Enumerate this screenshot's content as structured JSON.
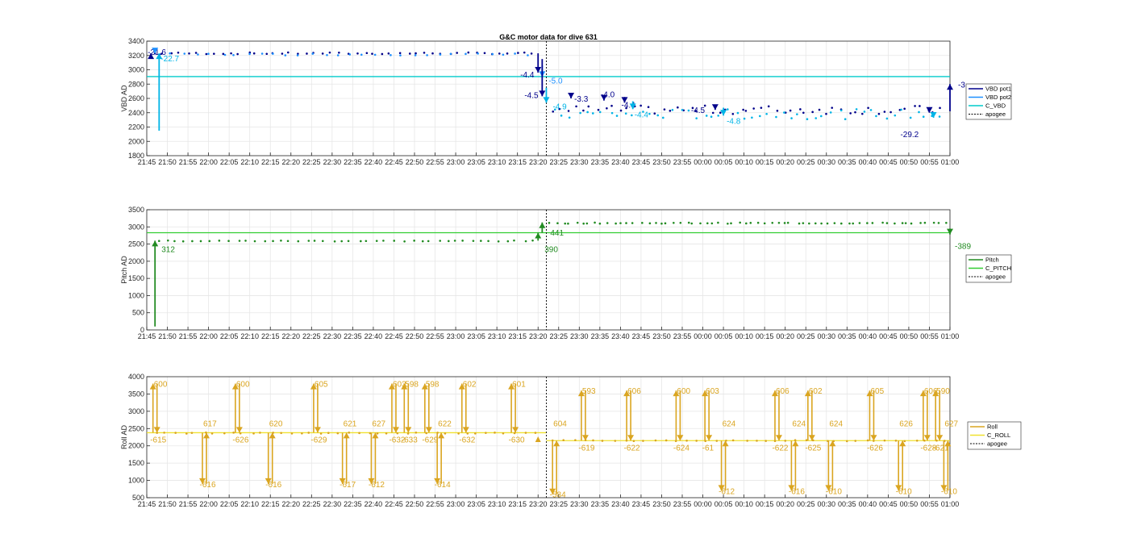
{
  "figure_title": "G&C motor data for dive 631",
  "x_ticks": [
    "21:45",
    "21:50",
    "21:55",
    "22:00",
    "22:05",
    "22:10",
    "22:15",
    "22:20",
    "22:25",
    "22:30",
    "22:35",
    "22:40",
    "22:45",
    "22:50",
    "22:55",
    "23:00",
    "23:05",
    "23:10",
    "23:15",
    "23:20",
    "23:25",
    "23:30",
    "23:35",
    "23:40",
    "23:45",
    "23:50",
    "23:55",
    "00:00",
    "00:05",
    "00:10",
    "00:15",
    "00:20",
    "00:25",
    "00:30",
    "00:35",
    "00:40",
    "00:45",
    "00:50",
    "00:55",
    "01:00"
  ],
  "apogee_time": "23:22",
  "chart_data": [
    {
      "type": "scatter",
      "ylabel": "VBD AD",
      "ylim": [
        3400,
        1800
      ],
      "yticks": [
        1800,
        2000,
        2200,
        2400,
        2600,
        2800,
        3000,
        3200,
        3400
      ],
      "reversed": true,
      "grid": true,
      "legend_position": "right",
      "legend": [
        {
          "name": "VBD pot1",
          "color": "#00008b",
          "style": "solid"
        },
        {
          "name": "VBD pot2",
          "color": "#1e90ff",
          "style": "solid"
        },
        {
          "name": "C_VBD",
          "color": "#00cccc",
          "style": "solid"
        },
        {
          "name": "apogee",
          "color": "#000000",
          "style": "dashed"
        }
      ],
      "reference_lines": [
        {
          "name": "C_VBD",
          "value": 2905,
          "color": "#00cccc"
        }
      ],
      "dot_series": [
        {
          "name": "VBD pot1",
          "color": "#00008b",
          "from": "21:47",
          "to": "23:19",
          "value": 3230,
          "count": 46,
          "jitter": 12
        },
        {
          "name": "VBD pot2",
          "color": "#1e90ff",
          "from": "21:48",
          "to": "23:18",
          "value": 3215,
          "count": 30,
          "jitter": 14
        },
        {
          "name": "VBD pot1",
          "color": "#00008b",
          "from": "23:24",
          "to": "00:58",
          "value": 2440,
          "count": 55,
          "jitter": 60
        },
        {
          "name": "VBD pot2",
          "color": "#00b4e6",
          "from": "23:24",
          "to": "00:58",
          "value": 2380,
          "count": 50,
          "jitter": 70
        }
      ],
      "arrows": [
        {
          "t": "21:46",
          "from": 3200,
          "to": 3230,
          "color": "#00008b",
          "label": "-21.6",
          "lx": -4,
          "ly": 2
        },
        {
          "t": "21:47",
          "from": 3260,
          "to": 3230,
          "color": "#1e90ff",
          "label": "",
          "lx": 0,
          "ly": 0
        },
        {
          "t": "21:48",
          "from": 2150,
          "to": 3230,
          "color": "#00b4e6",
          "label": "-22.7",
          "lx": 2,
          "ly": 10
        },
        {
          "t": "23:20",
          "from": 3230,
          "to": 2960,
          "color": "#00008b",
          "label": "-4.4",
          "lx": -22,
          "ly": 6
        },
        {
          "t": "23:21",
          "from": 3060,
          "to": 2900,
          "color": "#1e90ff",
          "label": "-5.0",
          "lx": 8,
          "ly": 8
        },
        {
          "t": "23:21",
          "from": 3150,
          "to": 2630,
          "color": "#00008b",
          "label": "-4.5",
          "lx": -22,
          "ly": 2
        },
        {
          "t": "23:22",
          "from": 2750,
          "to": 2540,
          "color": "#00b4e6",
          "label": "-4.9",
          "lx": 8,
          "ly": 8
        },
        {
          "t": "23:28",
          "from": 2640,
          "to": 2600,
          "color": "#00008b",
          "label": "-3.3",
          "lx": 4,
          "ly": 4
        },
        {
          "t": "23:36",
          "from": 2620,
          "to": 2570,
          "color": "#00008b",
          "label": "-4.0",
          "lx": -4,
          "ly": -4
        },
        {
          "t": "23:41",
          "from": 2620,
          "to": 2540,
          "color": "#00008b",
          "label": "-4.4",
          "lx": -4,
          "ly": 6
        },
        {
          "t": "23:43",
          "from": 2560,
          "to": 2450,
          "color": "#00b4e6",
          "label": "-4.4",
          "lx": 2,
          "ly": 10
        },
        {
          "t": "00:03",
          "from": 2500,
          "to": 2440,
          "color": "#00008b",
          "label": "-4.5",
          "lx": -30,
          "ly": 4
        },
        {
          "t": "00:05",
          "from": 2470,
          "to": 2360,
          "color": "#00b4e6",
          "label": "-4.8",
          "lx": 4,
          "ly": 10
        },
        {
          "t": "00:55",
          "from": 2440,
          "to": 2400,
          "color": "#00008b",
          "label": "-29.2",
          "lx": -36,
          "ly": 30
        },
        {
          "t": "00:56",
          "from": 2380,
          "to": 2330,
          "color": "#00b4e6",
          "label": "",
          "lx": 0,
          "ly": 0
        },
        {
          "t": "01:00",
          "from": 2420,
          "to": 2800,
          "color": "#00008b",
          "label": "-3",
          "lx": 10,
          "ly": 4
        }
      ]
    },
    {
      "type": "scatter",
      "ylabel": "Pitch AD",
      "ylim": [
        0,
        3500
      ],
      "yticks": [
        0,
        500,
        1000,
        1500,
        2000,
        2500,
        3000,
        3500
      ],
      "reversed": false,
      "grid": true,
      "legend_position": "right",
      "legend": [
        {
          "name": "Pitch",
          "color": "#228b22",
          "style": "solid"
        },
        {
          "name": "C_PITCH",
          "color": "#32cd32",
          "style": "solid"
        },
        {
          "name": "apogee",
          "color": "#000000",
          "style": "dashed"
        }
      ],
      "reference_lines": [
        {
          "name": "C_PITCH",
          "value": 2830,
          "color": "#32cd32"
        }
      ],
      "dot_series": [
        {
          "name": "Pitch",
          "color": "#228b22",
          "from": "21:48",
          "to": "23:19",
          "value": 2590,
          "count": 44,
          "jitter": 15
        },
        {
          "name": "Pitch",
          "color": "#228b22",
          "from": "23:23",
          "to": "00:59",
          "value": 3110,
          "count": 62,
          "jitter": 15
        }
      ],
      "arrows": [
        {
          "t": "21:47",
          "from": 100,
          "to": 2600,
          "color": "#228b22",
          "label": "312",
          "lx": 8,
          "ly": 14
        },
        {
          "t": "23:20",
          "from": 2600,
          "to": 2830,
          "color": "#228b22",
          "label": "390",
          "lx": 8,
          "ly": 24
        },
        {
          "t": "23:21",
          "from": 2830,
          "to": 3130,
          "color": "#228b22",
          "label": "441",
          "lx": 10,
          "ly": 16
        },
        {
          "t": "01:00",
          "from": 2950,
          "to": 2780,
          "color": "#228b22",
          "label": "-389",
          "lx": 6,
          "ly": 18
        }
      ]
    },
    {
      "type": "scatter",
      "ylabel": "Roll AD",
      "ylim": [
        500,
        4000
      ],
      "yticks": [
        500,
        1000,
        1500,
        2000,
        2500,
        3000,
        3500,
        4000
      ],
      "reversed": false,
      "grid": true,
      "legend_position": "right",
      "legend": [
        {
          "name": "Roll",
          "color": "#daa520",
          "style": "solid"
        },
        {
          "name": "C_ROLL",
          "color": "#f0e130",
          "style": "solid"
        },
        {
          "name": "apogee",
          "color": "#000000",
          "style": "dashed"
        }
      ],
      "reference_lines": [
        {
          "name": "C_ROLL",
          "value": 2380,
          "from": "21:45",
          "to": "23:22",
          "color": "#f0e130"
        },
        {
          "name": "C_ROLL",
          "value": 2150,
          "from": "23:22",
          "to": "01:00",
          "color": "#f0e130"
        }
      ],
      "dot_series": [
        {
          "name": "Roll",
          "color": "#daa520",
          "from": "21:47",
          "to": "23:19",
          "value": 2370,
          "count": 40,
          "jitter": 15
        },
        {
          "name": "Roll",
          "color": "#daa520",
          "from": "23:24",
          "to": "00:59",
          "value": 2150,
          "count": 40,
          "jitter": 15
        }
      ],
      "spikes": [
        {
          "t": "21:47",
          "peak": 3800,
          "base": 2380,
          "top_label": "600",
          "bottom_label": "-615"
        },
        {
          "t": "21:59",
          "peak": 900,
          "base": 2380,
          "top_label": "617",
          "bottom_label": "-616"
        },
        {
          "t": "22:07",
          "peak": 3800,
          "base": 2380,
          "top_label": "600",
          "bottom_label": "-626"
        },
        {
          "t": "22:15",
          "peak": 900,
          "base": 2380,
          "top_label": "620",
          "bottom_label": "-616"
        },
        {
          "t": "22:26",
          "peak": 3800,
          "base": 2380,
          "top_label": "605",
          "bottom_label": "-629"
        },
        {
          "t": "22:33",
          "peak": 900,
          "base": 2380,
          "top_label": "621",
          "bottom_label": "-617"
        },
        {
          "t": "22:40",
          "peak": 900,
          "base": 2380,
          "top_label": "627",
          "bottom_label": "-612"
        },
        {
          "t": "22:45",
          "peak": 3800,
          "base": 2380,
          "top_label": "603",
          "bottom_label": "-632"
        },
        {
          "t": "22:48",
          "peak": 3800,
          "base": 2380,
          "top_label": "598",
          "bottom_label": "-633"
        },
        {
          "t": "22:53",
          "peak": 3800,
          "base": 2380,
          "top_label": "598",
          "bottom_label": "-629"
        },
        {
          "t": "22:56",
          "peak": 900,
          "base": 2380,
          "top_label": "622",
          "bottom_label": "-614"
        },
        {
          "t": "23:02",
          "peak": 3800,
          "base": 2380,
          "top_label": "602",
          "bottom_label": "-632"
        },
        {
          "t": "23:14",
          "peak": 3800,
          "base": 2380,
          "top_label": "601",
          "bottom_label": "-630"
        },
        {
          "t": "23:24",
          "peak": 600,
          "base": 2150,
          "top_label": "604",
          "bottom_label": "-584"
        },
        {
          "t": "23:31",
          "peak": 3600,
          "base": 2150,
          "top_label": "593",
          "bottom_label": "-619"
        },
        {
          "t": "23:42",
          "peak": 3600,
          "base": 2150,
          "top_label": "606",
          "bottom_label": "-622"
        },
        {
          "t": "23:54",
          "peak": 3600,
          "base": 2150,
          "top_label": "600",
          "bottom_label": "-624"
        },
        {
          "t": "00:01",
          "peak": 3600,
          "base": 2150,
          "top_label": "603",
          "bottom_label": "-61"
        },
        {
          "t": "00:05",
          "peak": 700,
          "base": 2150,
          "top_label": "624",
          "bottom_label": "-612"
        },
        {
          "t": "00:18",
          "peak": 3600,
          "base": 2150,
          "top_label": "606",
          "bottom_label": "-622"
        },
        {
          "t": "00:22",
          "peak": 700,
          "base": 2150,
          "top_label": "624",
          "bottom_label": "-616"
        },
        {
          "t": "00:26",
          "peak": 3600,
          "base": 2150,
          "top_label": "602",
          "bottom_label": "-625"
        },
        {
          "t": "00:31",
          "peak": 700,
          "base": 2150,
          "top_label": "624",
          "bottom_label": "-610"
        },
        {
          "t": "00:41",
          "peak": 3600,
          "base": 2150,
          "top_label": "605",
          "bottom_label": "-626"
        },
        {
          "t": "00:48",
          "peak": 700,
          "base": 2150,
          "top_label": "626",
          "bottom_label": "-610"
        },
        {
          "t": "00:54",
          "peak": 3600,
          "base": 2150,
          "top_label": "606",
          "bottom_label": "-628"
        },
        {
          "t": "00:57",
          "peak": 3600,
          "base": 2150,
          "top_label": "590",
          "bottom_label": "-621"
        },
        {
          "t": "00:59",
          "peak": 700,
          "base": 2150,
          "top_label": "627",
          "bottom_label": "-610"
        }
      ],
      "markers": [
        {
          "t": "23:20",
          "value": 2180,
          "color": "#daa520"
        }
      ]
    }
  ]
}
